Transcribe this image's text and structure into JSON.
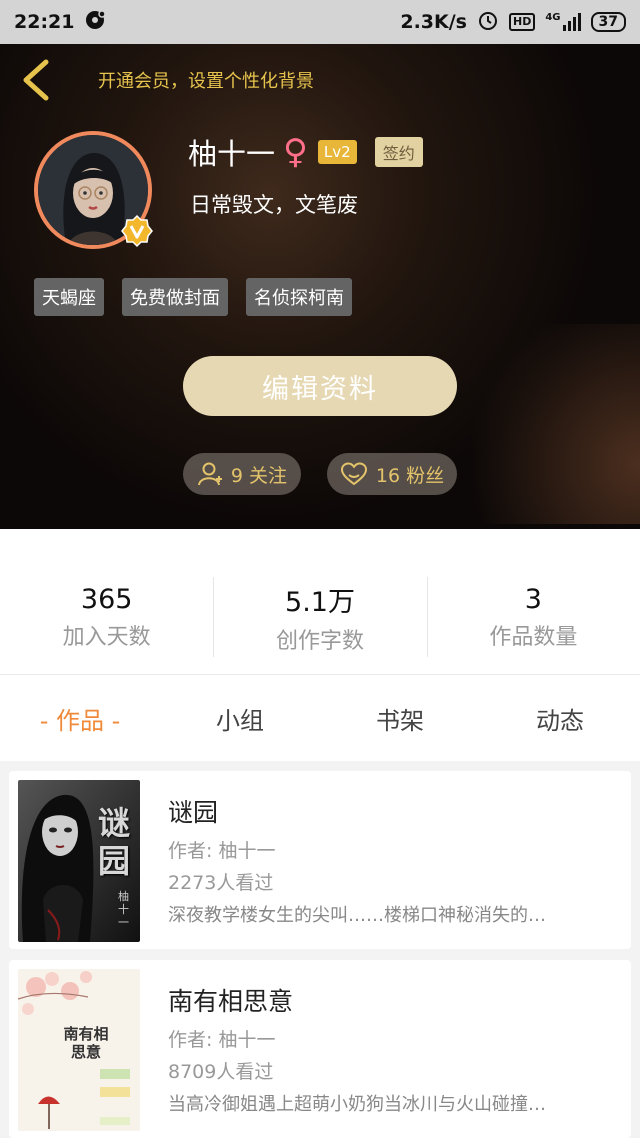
{
  "status_bar": {
    "time": "22:21",
    "network_speed": "2.3K/s",
    "hd_label": "HD",
    "network_type": "4G",
    "battery": "37"
  },
  "header": {
    "vip_hint": "开通会员，设置个性化背景",
    "username": "柚十一",
    "gender_symbol": "♀",
    "level": "Lv2",
    "sign_badge": "签约",
    "bio": "日常毁文，文笔废",
    "tags": [
      "天蝎座",
      "免费做封面",
      "名侦探柯南"
    ],
    "edit_button": "编辑资料",
    "follow": "9 关注",
    "fans": "16 粉丝",
    "accent_color": "#e6c34d"
  },
  "stats": [
    {
      "value": "365",
      "label": "加入天数"
    },
    {
      "value": "5.1万",
      "label": "创作字数"
    },
    {
      "value": "3",
      "label": "作品数量"
    }
  ],
  "tabs": [
    "- 作品 -",
    "小组",
    "书架",
    "动态"
  ],
  "active_tab_color": "#f08a3a",
  "books": [
    {
      "title": "谜园",
      "author": "作者: 柚十一",
      "views": "2273人看过",
      "desc": "深夜教学楼女生的尖叫……楼梯口神秘消失的…",
      "cover_title": "谜园",
      "cover_author": "柚十一"
    },
    {
      "title": "南有相思意",
      "author": "作者: 柚十一",
      "views": "8709人看过",
      "desc": "当高冷御姐遇上超萌小奶狗当冰川与火山碰撞…",
      "cover_title": "南有相思意"
    }
  ]
}
